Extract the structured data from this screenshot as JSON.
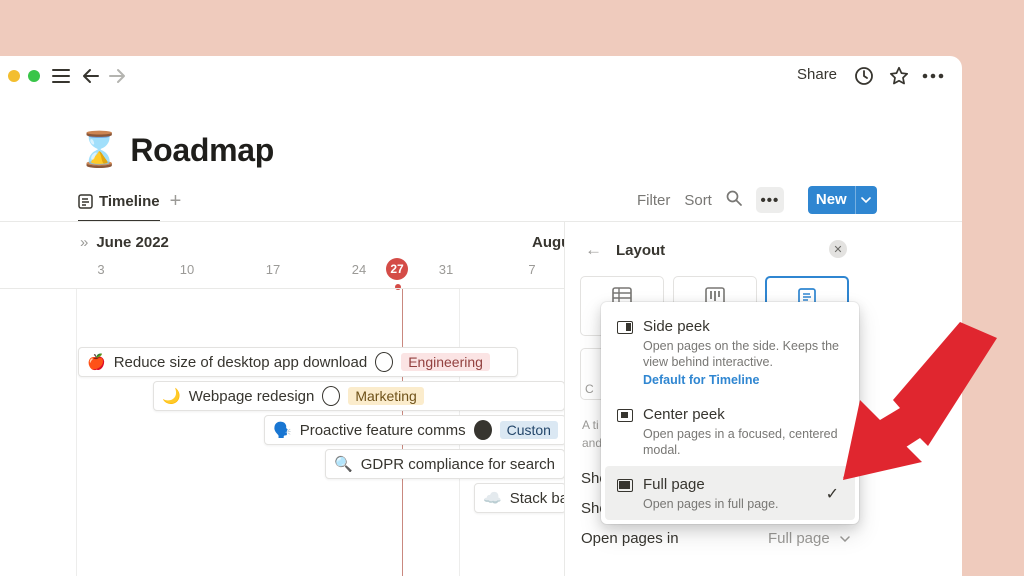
{
  "window": {
    "share_label": "Share"
  },
  "page": {
    "emoji": "⌛",
    "title": "Roadmap"
  },
  "tabs": [
    {
      "label": "Timeline",
      "active": true
    }
  ],
  "toolbar": {
    "filter_label": "Filter",
    "sort_label": "Sort",
    "dots_label": "•••",
    "new_label": "New"
  },
  "timeline": {
    "month_label": "June 2022",
    "next_month_label": "Augu",
    "days": [
      "3",
      "10",
      "17",
      "24",
      "27",
      "31",
      "7"
    ],
    "today": "27",
    "items": [
      {
        "emoji": "🍎",
        "title": "Reduce size of desktop app download",
        "tag": "Engineering",
        "tag_bg": "#fbe4e4",
        "tag_color": "#93413f"
      },
      {
        "emoji": "🌙",
        "title": "Webpage redesign",
        "tag": "Marketing",
        "tag_bg": "#fbeccc",
        "tag_color": "#6f5219"
      },
      {
        "emoji": "🗣️",
        "title": "Proactive feature comms",
        "tag": "Custon",
        "tag_bg": "#dbe8f3",
        "tag_color": "#24476b"
      },
      {
        "emoji": "🔍",
        "title": "GDPR compliance for search",
        "tag": "",
        "tag_bg": "",
        "tag_color": ""
      },
      {
        "emoji": "☁️",
        "title": "Stack ba",
        "tag": "",
        "tag_bg": "",
        "tag_color": ""
      }
    ]
  },
  "layout_panel": {
    "title": "Layout",
    "fragments": [
      "A ti",
      "and",
      "Sho",
      "Sho",
      "C"
    ],
    "open_pages_label": "Open pages in",
    "open_pages_value": "Full page"
  },
  "menu": {
    "options": [
      {
        "title": "Side peek",
        "description": "Open pages on the side. Keeps the view behind interactive.",
        "note": "Default for Timeline",
        "selected": false
      },
      {
        "title": "Center peek",
        "description": "Open pages in a focused, centered modal.",
        "note": "",
        "selected": false
      },
      {
        "title": "Full page",
        "description": "Open pages in full page.",
        "note": "",
        "selected": true
      }
    ],
    "check_glyph": "✓"
  },
  "colors": {
    "accent": "#2f86d1",
    "today": "#d44c47",
    "annotation_arrow": "#e0262f",
    "background": "#efcbbd"
  }
}
